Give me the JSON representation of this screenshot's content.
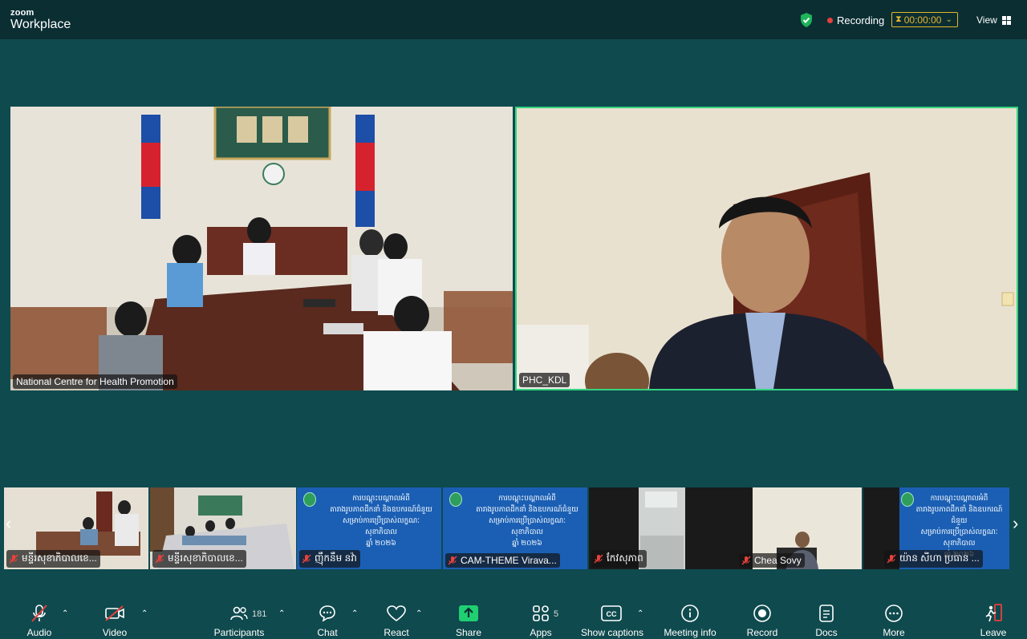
{
  "app": {
    "logo_top": "zoom",
    "logo_bottom": "Workplace"
  },
  "topbar": {
    "recording_label": "Recording",
    "timer": "00:00:00",
    "view_label": "View"
  },
  "colors": {
    "background": "#0f4a4e",
    "topbar": "#0b2e33",
    "active_speaker_border": "#35d37f",
    "recording_dot": "#e8413c",
    "timer_accent": "#e7b52c"
  },
  "tiles": [
    {
      "label": "National Centre for Health Promotion"
    },
    {
      "label": "PHC_KDL"
    }
  ],
  "thumbnails": [
    {
      "label": "មន្ទីរសុខាភិបាលខេ..."
    },
    {
      "label": "មន្ទីរសុខាភិបាលខេ..."
    },
    {
      "label": "ញ៉ឹកនឹម នវ៉ា"
    },
    {
      "label": "CAM-THEME Virava..."
    },
    {
      "label": "កែវសុភាព"
    },
    {
      "label": "Chea Sovy"
    },
    {
      "label": "យ៉ាន សីហា ប្រធាន ..."
    }
  ],
  "slide": {
    "line1": "ការបណ្តុះបណ្តាលអំពី",
    "line2": "តារាងរូបភាពដឹកនាំ និងឧបករណ៍ជំនួយ",
    "line3": "សម្រាប់ការប្រើប្រាស់លក្ខណៈសុខាភិបាល",
    "line4": "ឆ្នាំ ២០២៦"
  },
  "toolbar": {
    "audio": "Audio",
    "video": "Video",
    "participants": "Participants",
    "participants_count": "181",
    "chat": "Chat",
    "react": "React",
    "share": "Share",
    "apps": "Apps",
    "apps_count": "5",
    "captions": "Show captions",
    "meeting_info": "Meeting info",
    "record": "Record",
    "docs": "Docs",
    "more": "More",
    "leave": "Leave"
  }
}
